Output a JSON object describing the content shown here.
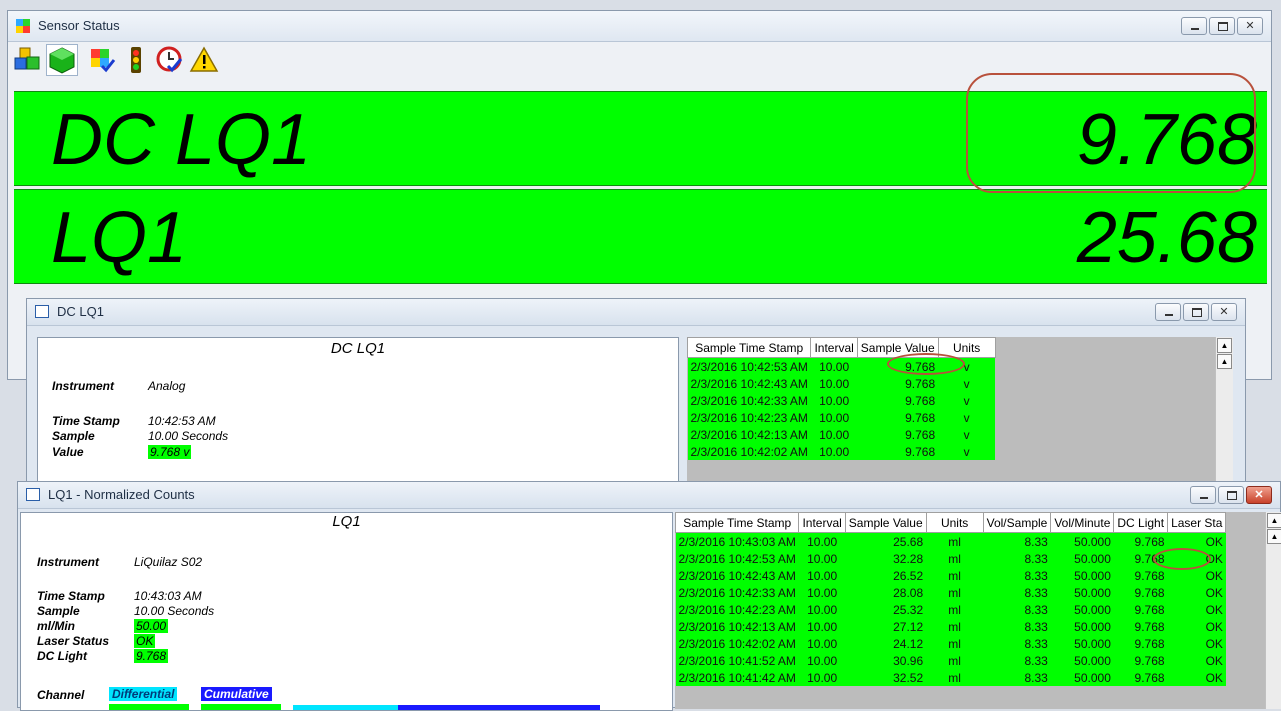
{
  "main": {
    "title": "Sensor Status",
    "toolbar_icons": [
      "cubes-icon",
      "green-cube-icon",
      "grid-check-icon",
      "traffic-light-icon",
      "clock-check-icon",
      "warning-icon"
    ],
    "rows": [
      {
        "name": "DC LQ1",
        "value": "9.768"
      },
      {
        "name": "LQ1",
        "value": "25.68"
      }
    ]
  },
  "dc": {
    "title": "DC LQ1",
    "panel_title": "DC LQ1",
    "instrument_label": "Instrument",
    "instrument": "Analog",
    "timestamp_label": "Time Stamp",
    "timestamp": "10:42:53 AM",
    "sample_label": "Sample",
    "sample": "10.00 Seconds",
    "value_label": "Value",
    "value": "9.768 v",
    "columns": [
      "Sample Time Stamp",
      "Interval",
      "Sample Value",
      "Units"
    ],
    "rows": [
      [
        "2/3/2016 10:42:53 AM",
        "10.00",
        "9.768",
        "v"
      ],
      [
        "2/3/2016 10:42:43 AM",
        "10.00",
        "9.768",
        "v"
      ],
      [
        "2/3/2016 10:42:33 AM",
        "10.00",
        "9.768",
        "v"
      ],
      [
        "2/3/2016 10:42:23 AM",
        "10.00",
        "9.768",
        "v"
      ],
      [
        "2/3/2016 10:42:13 AM",
        "10.00",
        "9.768",
        "v"
      ],
      [
        "2/3/2016 10:42:02 AM",
        "10.00",
        "9.768",
        "v"
      ]
    ]
  },
  "lq": {
    "title": "LQ1 - Normalized Counts",
    "panel_title": "LQ1",
    "instrument_label": "Instrument",
    "instrument": "LiQuilaz S02",
    "timestamp_label": "Time Stamp",
    "timestamp": "10:43:03 AM",
    "sample_label": "Sample",
    "sample": "10.00 Seconds",
    "mlmin_label": "ml/Min",
    "mlmin": "50.00",
    "laser_label": "Laser Status",
    "laser": "OK",
    "dclight_label": "DC Light",
    "dclight": "9.768",
    "channel_label": "Channel",
    "diff_label": "Differential",
    "cum_label": "Cumulative",
    "columns": [
      "Sample Time Stamp",
      "Interval",
      "Sample Value",
      "Units",
      "Vol/Sample",
      "Vol/Minute",
      "DC Light",
      "Laser Sta"
    ],
    "rows": [
      [
        "2/3/2016 10:43:03 AM",
        "10.00",
        "25.68",
        "ml",
        "8.33",
        "50.000",
        "9.768",
        "OK"
      ],
      [
        "2/3/2016 10:42:53 AM",
        "10.00",
        "32.28",
        "ml",
        "8.33",
        "50.000",
        "9.768",
        "OK"
      ],
      [
        "2/3/2016 10:42:43 AM",
        "10.00",
        "26.52",
        "ml",
        "8.33",
        "50.000",
        "9.768",
        "OK"
      ],
      [
        "2/3/2016 10:42:33 AM",
        "10.00",
        "28.08",
        "ml",
        "8.33",
        "50.000",
        "9.768",
        "OK"
      ],
      [
        "2/3/2016 10:42:23 AM",
        "10.00",
        "25.32",
        "ml",
        "8.33",
        "50.000",
        "9.768",
        "OK"
      ],
      [
        "2/3/2016 10:42:13 AM",
        "10.00",
        "27.12",
        "ml",
        "8.33",
        "50.000",
        "9.768",
        "OK"
      ],
      [
        "2/3/2016 10:42:02 AM",
        "10.00",
        "24.12",
        "ml",
        "8.33",
        "50.000",
        "9.768",
        "OK"
      ],
      [
        "2/3/2016 10:41:52 AM",
        "10.00",
        "30.96",
        "ml",
        "8.33",
        "50.000",
        "9.768",
        "OK"
      ],
      [
        "2/3/2016 10:41:42 AM",
        "10.00",
        "32.52",
        "ml",
        "8.33",
        "50.000",
        "9.768",
        "OK"
      ]
    ]
  }
}
